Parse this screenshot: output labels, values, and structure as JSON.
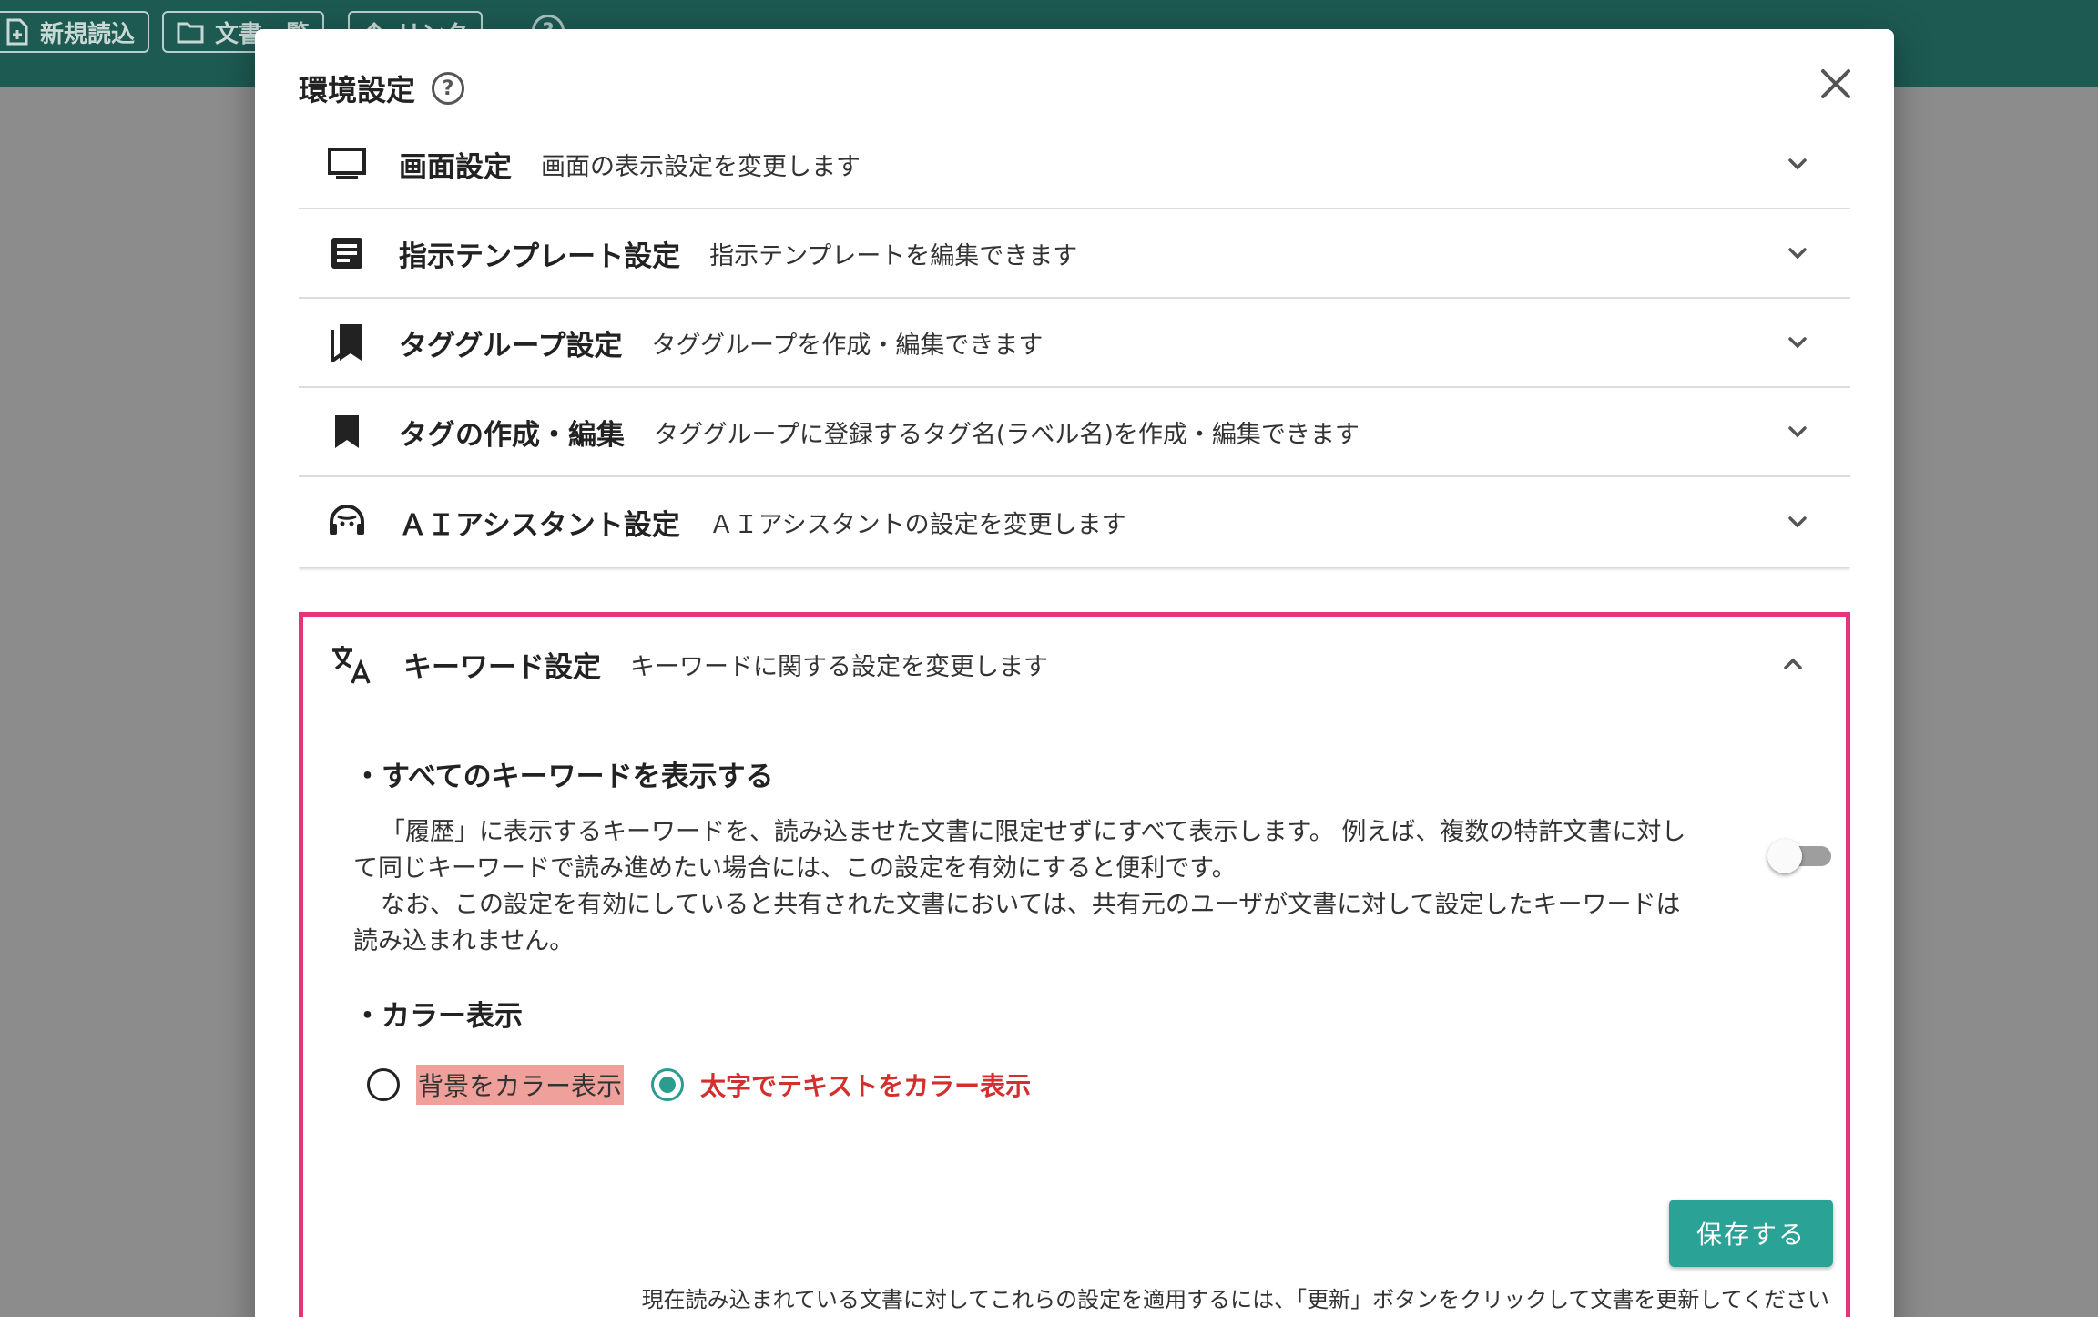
{
  "app_toolbar": {
    "buttons": [
      {
        "label": "新規読込",
        "icon": "file-plus-icon"
      },
      {
        "label": "文書一覧",
        "icon": "folder-icon"
      },
      {
        "label": "リンク",
        "icon": "upload-icon"
      }
    ],
    "help": "?"
  },
  "modal": {
    "title": "環境設定",
    "help_icon": "?",
    "close_icon": "close-icon"
  },
  "sections": [
    {
      "icon": "monitor-icon",
      "title": "画面設定",
      "desc": "画面の表示設定を変更します",
      "expanded": false
    },
    {
      "icon": "document-icon",
      "title": "指示テンプレート設定",
      "desc": "指示テンプレートを編集できます",
      "expanded": false
    },
    {
      "icon": "bookmarks-icon",
      "title": "タググループ設定",
      "desc": "タググループを作成・編集できます",
      "expanded": false
    },
    {
      "icon": "bookmark-icon",
      "title": "タグの作成・編集",
      "desc": "タググループに登録するタグ名(ラベル名)を作成・編集できます",
      "expanded": false
    },
    {
      "icon": "headset-icon",
      "title": "ＡＩアシスタント設定",
      "desc": "ＡＩアシスタントの設定を変更します",
      "expanded": false
    }
  ],
  "keyword_section": {
    "icon": "translate-icon",
    "title": "キーワード設定",
    "desc": "キーワードに関する設定を変更します",
    "expanded": true,
    "show_all": {
      "title": "・すべてのキーワードを表示する",
      "text1": "「履歴」に表示するキーワードを、読み込ませた文書に限定せずにすべて表示します。 例えば、複数の特許文書に対して同じキーワードで読み進めたい場合には、この設定を有効にすると便利です。",
      "text2": "なお、この設定を有効にしていると共有された文書においては、共有元のユーザが文書に対して設定したキーワードは読み込まれません。",
      "enabled": false
    },
    "color_display": {
      "title": "・カラー表示",
      "options": [
        {
          "label": "背景をカラー表示",
          "selected": false
        },
        {
          "label": "太字でテキストをカラー表示",
          "selected": true
        }
      ]
    },
    "save_label": "保存する",
    "footnote": "現在読み込まれている文書に対してこれらの設定を適用するには、「更新」ボタンをクリックして文書を更新してください"
  },
  "colors": {
    "accent": "#2aa296",
    "highlight_border": "#e4347a",
    "bg_highlight": "#f0a09b",
    "bold_text": "#d32f2f"
  }
}
